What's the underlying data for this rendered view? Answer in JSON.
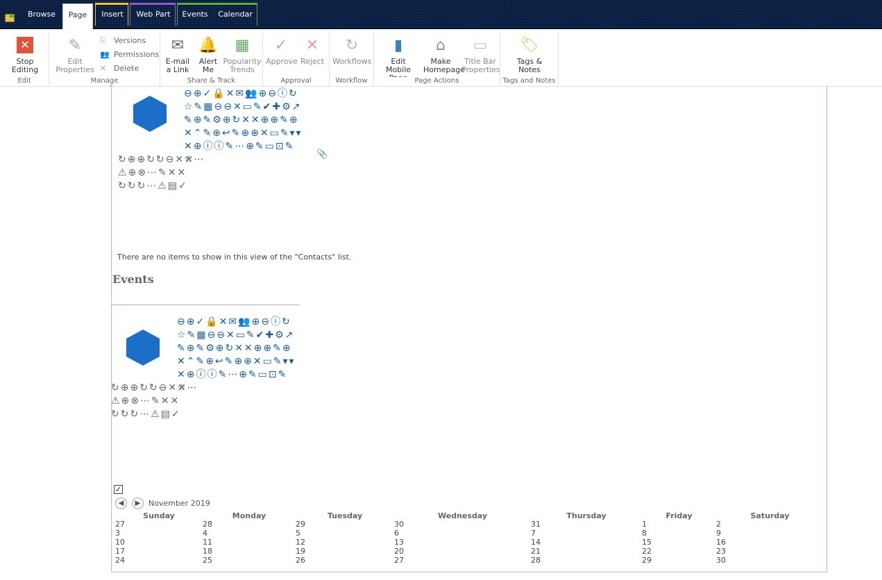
{
  "tabs": [
    {
      "label": "Browse"
    },
    {
      "label": "Page"
    },
    {
      "label": "Insert"
    },
    {
      "label": "Web Part"
    },
    {
      "label": "Events"
    },
    {
      "label": "Calendar"
    }
  ],
  "colors": {
    "insert": "#f0c419",
    "webpart": "#8a5fd6",
    "calendar": "#5fae3c",
    "accent": "#0072c6"
  },
  "ribbon": {
    "groups": [
      "Edit",
      "Manage",
      "Share & Track",
      "Approval",
      "Workflow",
      "Page Actions",
      "Tags and Notes"
    ],
    "stop_editing": "Stop Editing",
    "edit_properties": "Edit Properties",
    "versions": "Versions",
    "permissions": "Permissions",
    "delete_page": "Delete Page",
    "email_link": "E-mail a Link",
    "alert_me": "Alert Me",
    "popularity_trends": "Popularity Trends",
    "approve": "Approve",
    "reject": "Reject",
    "workflows": "Workflows",
    "edit_mobile_page": "Edit Mobile Page",
    "make_homepage": "Make Homepage",
    "title_bar_properties": "Title Bar Properties",
    "tags_notes": "Tags & Notes"
  },
  "contacts": {
    "empty_message": "There are no items to show in this view of the \"Contacts\" list."
  },
  "events": {
    "heading": "Events"
  },
  "calendar": {
    "month": "November 2019",
    "days": [
      "Sunday",
      "Monday",
      "Tuesday",
      "Wednesday",
      "Thursday",
      "Friday",
      "Saturday"
    ],
    "weeks": [
      [
        "27",
        "28",
        "29",
        "30",
        "31",
        "1",
        "2"
      ],
      [
        "3",
        "4",
        "5",
        "6",
        "7",
        "8",
        "9"
      ],
      [
        "10",
        "11",
        "12",
        "13",
        "14",
        "15",
        "16"
      ],
      [
        "17",
        "18",
        "19",
        "20",
        "21",
        "22",
        "23"
      ],
      [
        "24",
        "25",
        "26",
        "27",
        "28",
        "29",
        "30"
      ]
    ]
  }
}
